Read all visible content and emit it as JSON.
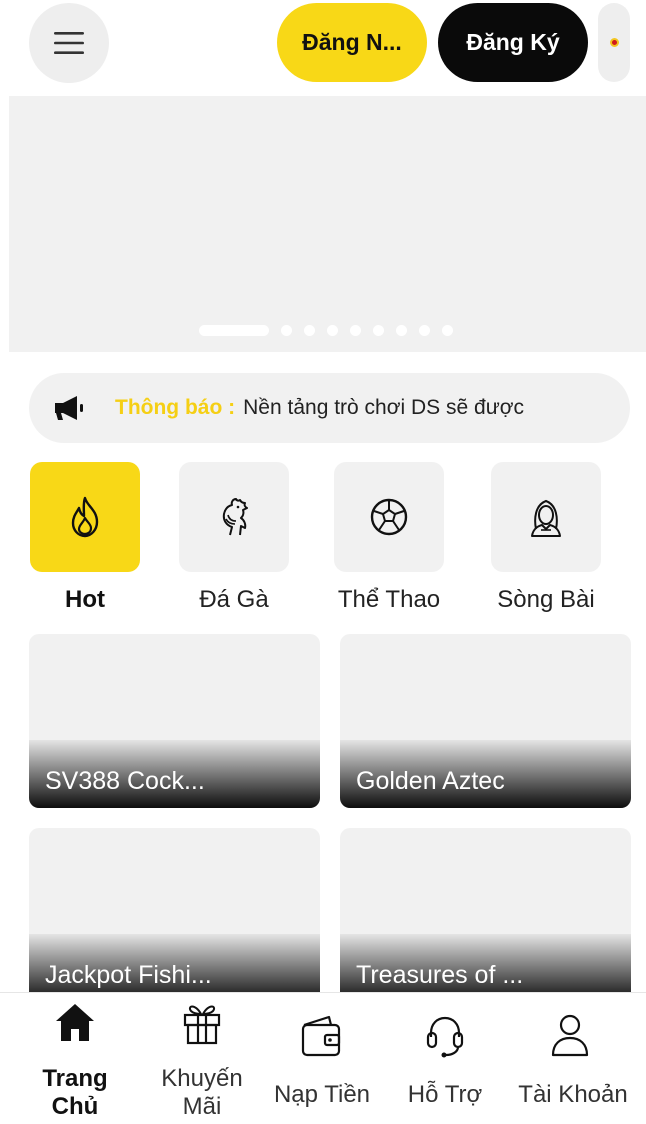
{
  "header": {
    "login_label": "Đăng N...",
    "register_label": "Đăng Ký",
    "menu_icon": "hamburger-menu-icon",
    "language_icon": "flag-icon"
  },
  "banner": {
    "slide_count": 9,
    "active_slide": 1
  },
  "notice": {
    "icon": "megaphone-icon",
    "label": "Thông báo :",
    "text": "Nền tảng trò chơi DS sẽ được"
  },
  "categories": [
    {
      "label": "Hot",
      "icon": "flame-icon",
      "active": true
    },
    {
      "label": "Đá Gà",
      "icon": "rooster-icon",
      "active": false
    },
    {
      "label": "Thể Thao",
      "icon": "soccer-ball-icon",
      "active": false
    },
    {
      "label": "Sòng Bài",
      "icon": "dealer-icon",
      "active": false
    }
  ],
  "games": [
    {
      "title": "SV388 Cock..."
    },
    {
      "title": "Golden Aztec"
    },
    {
      "title": "Jackpot Fishi..."
    },
    {
      "title": "Treasures of ..."
    }
  ],
  "bottom_nav": [
    {
      "line1": "Trang",
      "line2": "Chủ",
      "icon": "home-icon",
      "active": true
    },
    {
      "line1": "Khuyến",
      "line2": "Mãi",
      "icon": "gift-icon",
      "active": false
    },
    {
      "line1": "Nạp Tiền",
      "line2": "",
      "icon": "wallet-icon",
      "active": false
    },
    {
      "line1": "Hỗ Trợ",
      "line2": "",
      "icon": "headset-icon",
      "active": false
    },
    {
      "line1": "Tài Khoản",
      "line2": "",
      "icon": "user-icon",
      "active": false
    }
  ],
  "colors": {
    "accent": "#f8d817",
    "dark": "#0a0a0a",
    "tile": "#f1f1f1"
  }
}
